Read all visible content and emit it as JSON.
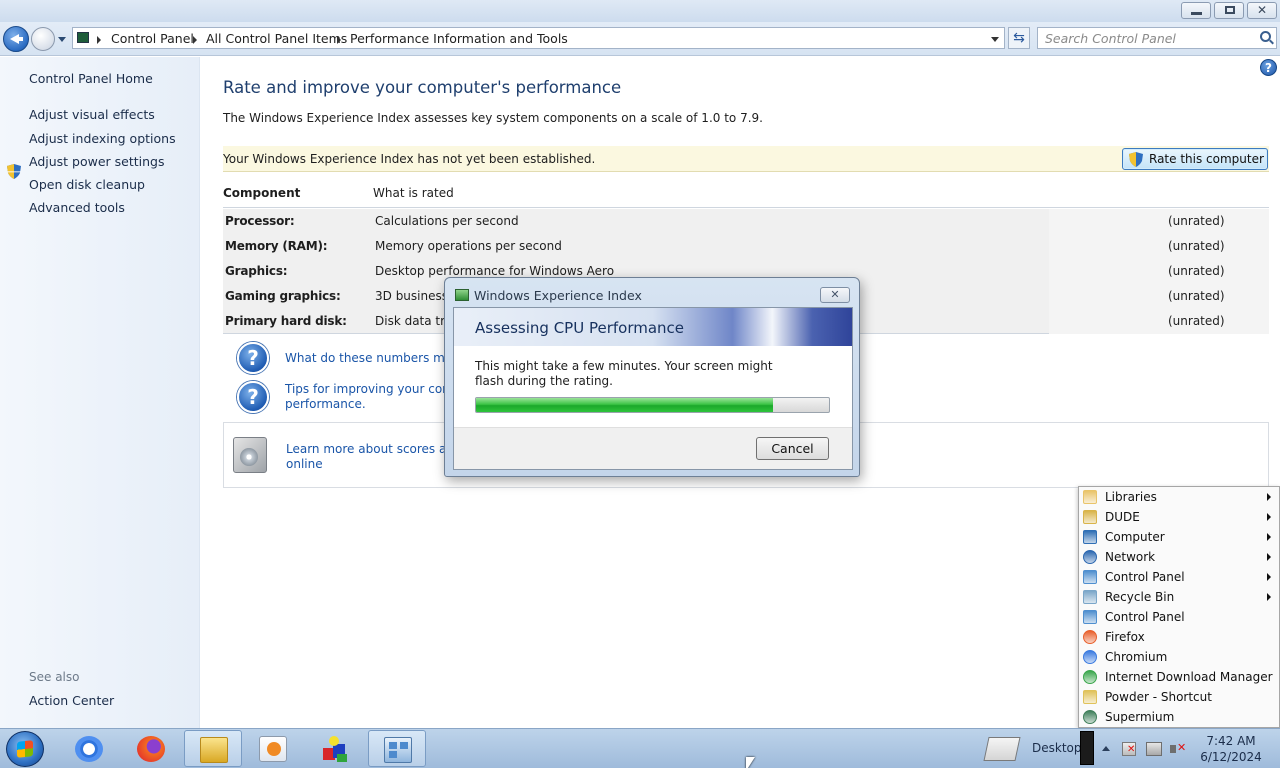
{
  "window": {
    "breadcrumb": [
      "Control Panel",
      "All Control Panel Items",
      "Performance Information and Tools"
    ],
    "search_placeholder": "Search Control Panel"
  },
  "sidebar": {
    "home": "Control Panel Home",
    "items": [
      {
        "label": "Adjust visual effects",
        "icon": "shield-icon"
      },
      {
        "label": "Adjust indexing options"
      },
      {
        "label": "Adjust power settings"
      },
      {
        "label": "Open disk cleanup"
      },
      {
        "label": "Advanced tools"
      }
    ],
    "see_also_label": "See also",
    "see_also_items": [
      "Action Center"
    ]
  },
  "main": {
    "title": "Rate and improve your computer's performance",
    "description": "The Windows Experience Index assesses key system components on a scale of 1.0 to 7.9.",
    "banner_text": "Your Windows Experience Index has not yet been established.",
    "rate_button": "Rate this computer",
    "table_headers": [
      "Component",
      "What is rated"
    ],
    "rows": [
      {
        "component": "Processor:",
        "what": "Calculations per second",
        "score": "(unrated)"
      },
      {
        "component": "Memory (RAM):",
        "what": "Memory operations per second",
        "score": "(unrated)"
      },
      {
        "component": "Graphics:",
        "what": "Desktop performance for Windows Aero",
        "score": "(unrated)"
      },
      {
        "component": "Gaming graphics:",
        "what": "3D business a",
        "score": "(unrated)"
      },
      {
        "component": "Primary hard disk:",
        "what": "Disk data tran",
        "score": "(unrated)"
      }
    ],
    "links": {
      "numbers_mean": "What do these numbers mean",
      "tips_line1": "Tips for improving your comp",
      "tips_line2": "performance.",
      "learn_line1": "Learn more about scores and",
      "learn_line2": "online"
    }
  },
  "dialog": {
    "title": "Windows Experience Index",
    "heading": "Assessing CPU Performance",
    "message": "This might take a few minutes. Your screen might flash during the rating.",
    "progress": 0.84,
    "cancel": "Cancel"
  },
  "jump_menu": {
    "items": [
      {
        "label": "Libraries",
        "submenu": true,
        "icon": "libraries-icon",
        "color": "#e9c46a"
      },
      {
        "label": "DUDE",
        "submenu": true,
        "icon": "user-folder-icon",
        "color": "#d9b44a"
      },
      {
        "label": "Computer",
        "submenu": true,
        "icon": "computer-icon",
        "color": "#2f6fb5"
      },
      {
        "label": "Network",
        "submenu": true,
        "icon": "network-icon",
        "color": "#2b67b0"
      },
      {
        "label": "Control Panel",
        "submenu": true,
        "icon": "control-panel-icon",
        "color": "#4f8fcf"
      },
      {
        "label": "Recycle Bin",
        "submenu": true,
        "icon": "recycle-bin-icon",
        "color": "#7aa6c9"
      },
      {
        "label": "Control Panel",
        "submenu": false,
        "icon": "control-panel-icon",
        "color": "#4f8fcf"
      },
      {
        "label": "Firefox",
        "submenu": false,
        "icon": "firefox-icon",
        "color": "#e8602c"
      },
      {
        "label": "Chromium",
        "submenu": false,
        "icon": "chromium-icon",
        "color": "#3b7be0"
      },
      {
        "label": "Internet Download Manager",
        "submenu": false,
        "icon": "idm-icon",
        "color": "#3aa64c"
      },
      {
        "label": "Powder - Shortcut",
        "submenu": false,
        "icon": "shortcut-icon",
        "color": "#e0c25a"
      },
      {
        "label": "Supermium",
        "submenu": false,
        "icon": "supermium-icon",
        "color": "#3f7f5a"
      }
    ]
  },
  "taskbar": {
    "desktop_label": "Desktop",
    "time": "7:42 AM",
    "date": "6/12/2024"
  }
}
